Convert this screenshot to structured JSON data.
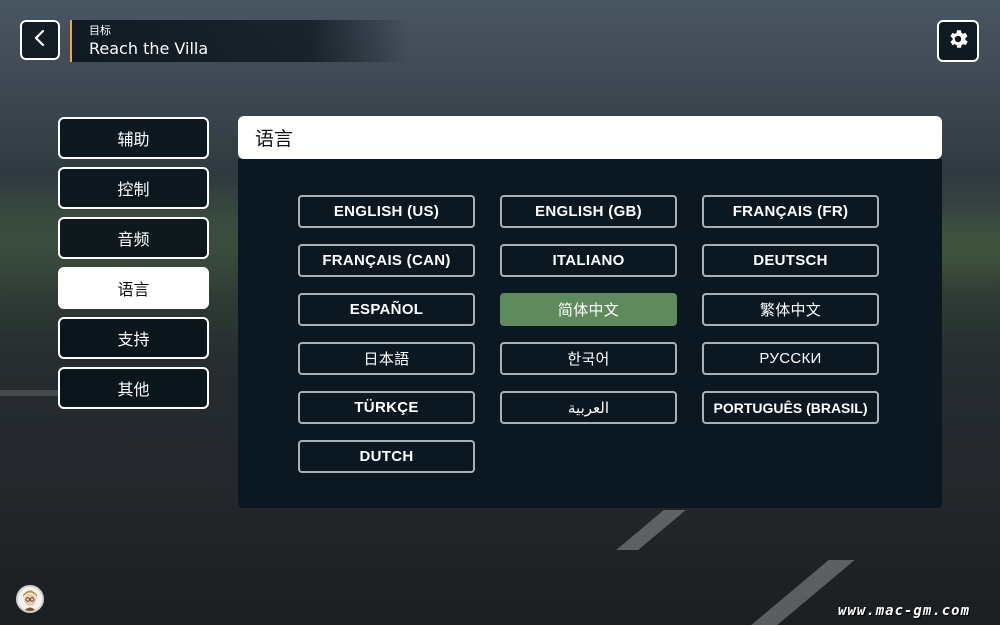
{
  "header": {
    "goal_label": "目标",
    "goal_title": "Reach the Villa"
  },
  "sidebar": {
    "items": [
      {
        "label": "辅助",
        "active": false
      },
      {
        "label": "控制",
        "active": false
      },
      {
        "label": "音频",
        "active": false
      },
      {
        "label": "语言",
        "active": true
      },
      {
        "label": "支持",
        "active": false
      },
      {
        "label": "其他",
        "active": false
      }
    ]
  },
  "panel": {
    "title": "语言",
    "selected_language": "简体中文",
    "languages": [
      "ENGLISH (US)",
      "ENGLISH (GB)",
      "FRANÇAIS (FR)",
      "FRANÇAIS (CAN)",
      "ITALIANO",
      "DEUTSCH",
      "ESPAÑOL",
      "简体中文",
      "繁体中文",
      "日本語",
      "한국어",
      "РУССКИ",
      "TÜRKÇE",
      "العربية",
      "PORTUGUÊS (BRASIL)",
      "DUTCH"
    ]
  },
  "icons": {
    "back": "chevron-left-icon",
    "settings": "gear-icon",
    "avatar": "avatar-icon"
  },
  "colors": {
    "accent_selected": "#5f8a5e",
    "goal_accent": "#e3a94a",
    "panel_bg": "#0b1822"
  },
  "watermark": "www.mac-gm.com"
}
